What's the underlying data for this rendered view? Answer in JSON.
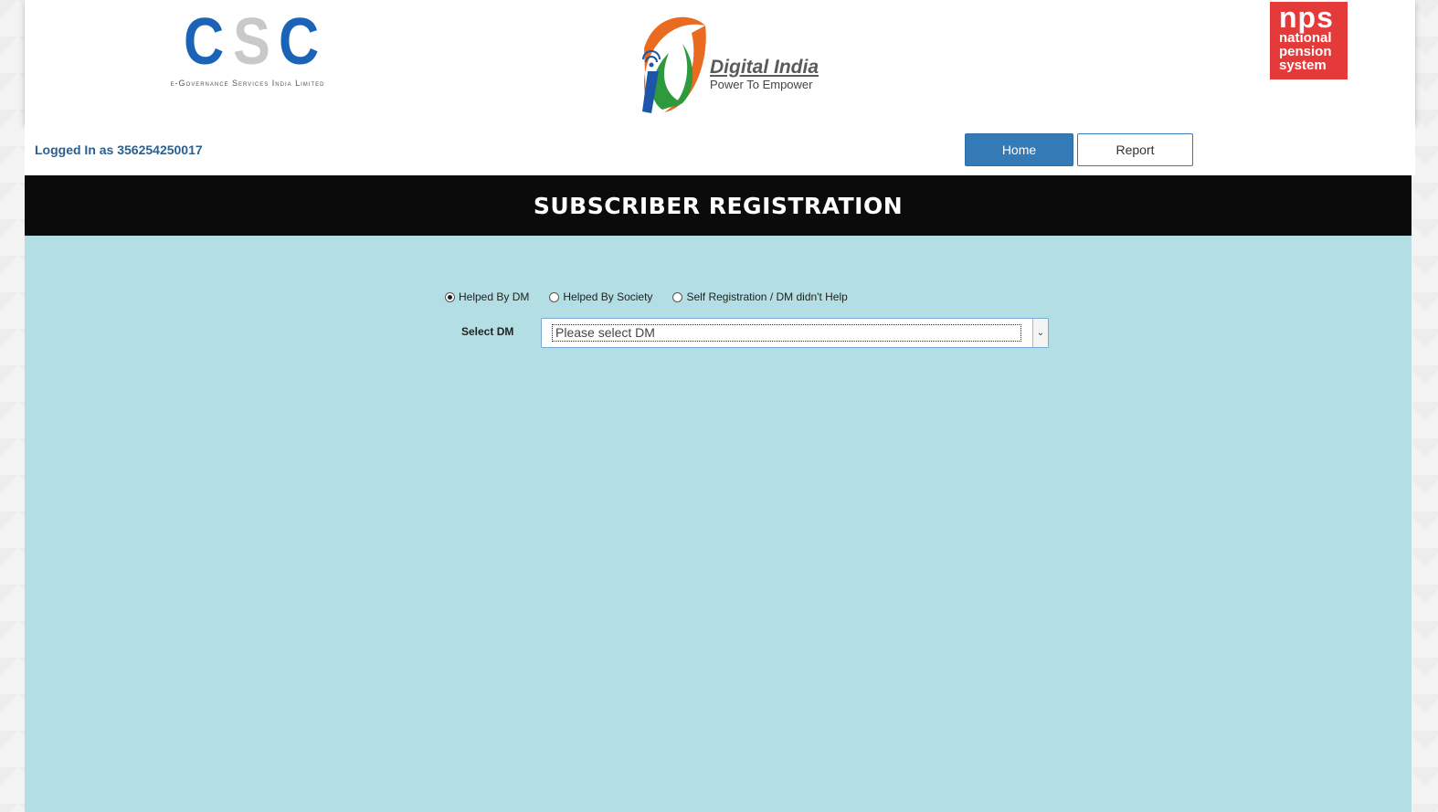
{
  "header": {
    "csc_logo": {
      "letters": [
        "C",
        "S",
        "C"
      ],
      "tagline": "e-Governance Services India Limited"
    },
    "digital_india_logo": {
      "title": "Digital India",
      "tagline": "Power To Empower"
    },
    "nps_logo": {
      "big": "nps",
      "line1": "national",
      "line2": "pension",
      "line3": "system",
      "color": "#e43a3a"
    }
  },
  "login_bar": {
    "logged_in_text": "Logged In as 356254250017",
    "nav": {
      "home_label": "Home",
      "report_label": "Report"
    }
  },
  "page_title": "SUBSCRIBER REGISTRATION",
  "form": {
    "radio_options": [
      {
        "label": "Helped By DM",
        "checked": true
      },
      {
        "label": "Helped By Society",
        "checked": false
      },
      {
        "label": "Self Registration / DM didn't Help",
        "checked": false
      }
    ],
    "select_dm": {
      "label": "Select DM",
      "value": "Please select DM"
    }
  },
  "colors": {
    "accent": "#337ab7",
    "content_bg": "#b3dfe4",
    "title_bg": "#0b0b0b"
  }
}
